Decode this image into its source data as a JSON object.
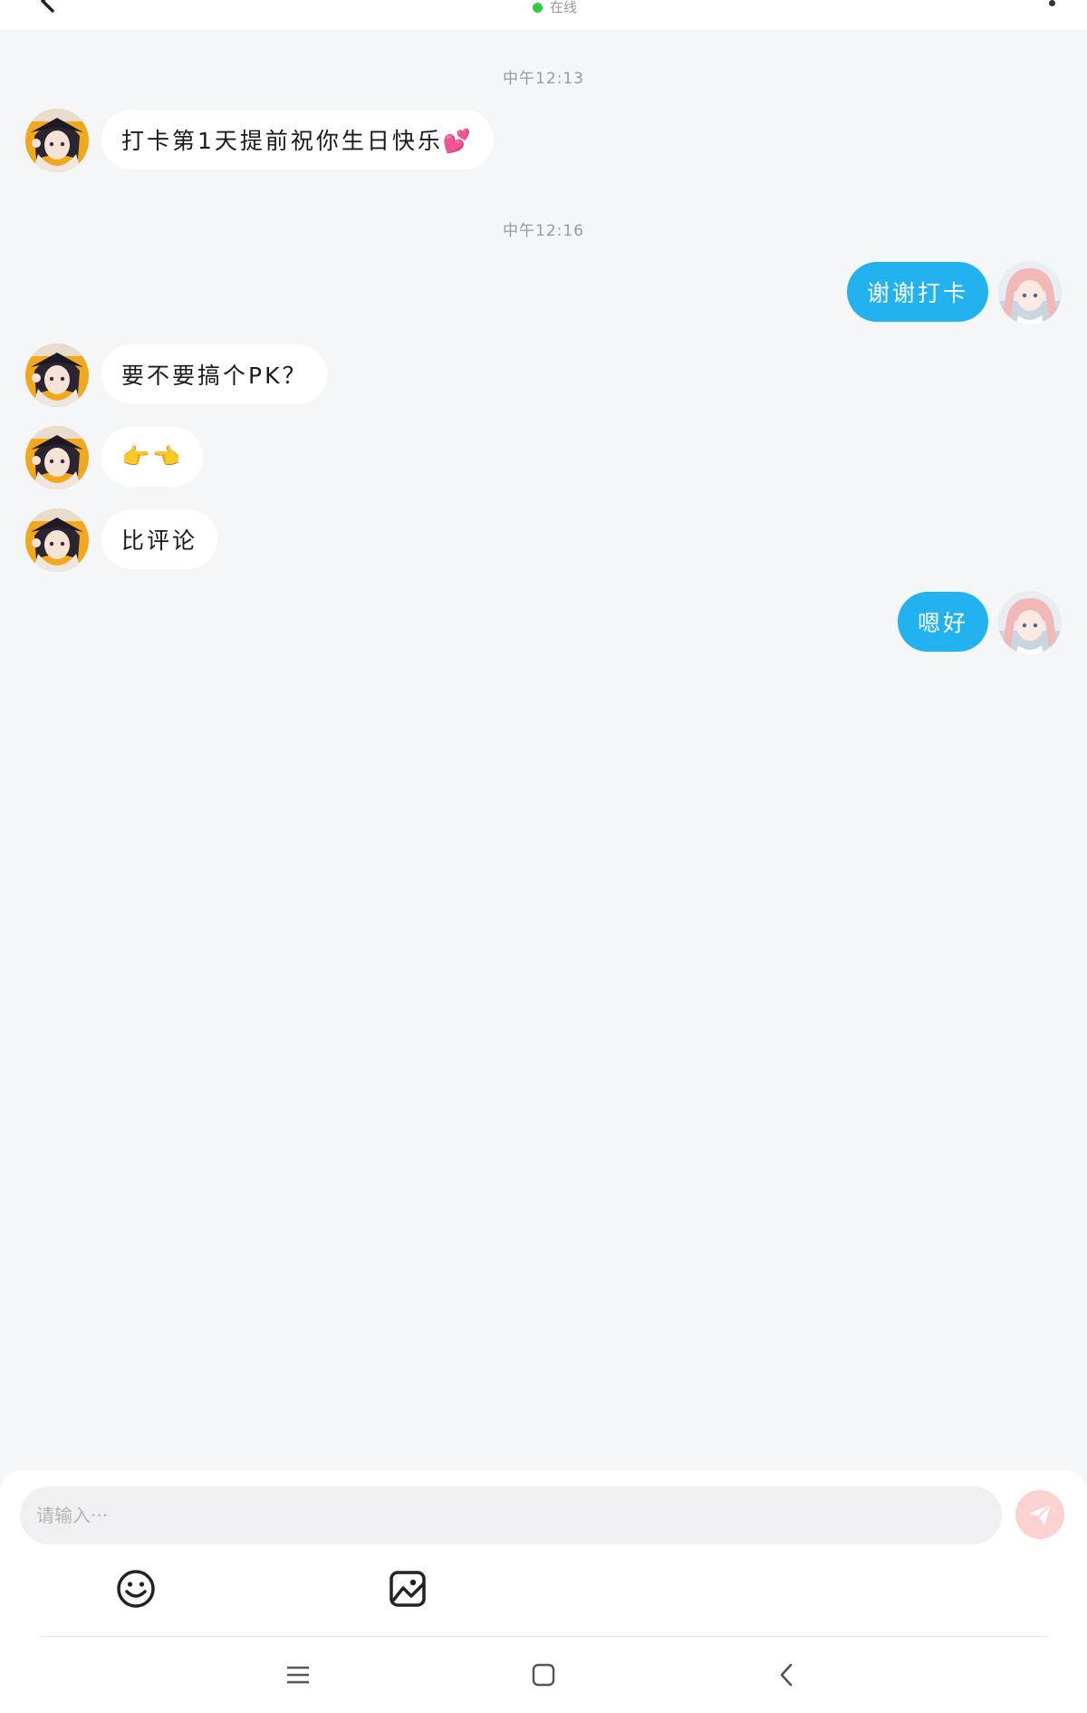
{
  "header": {
    "status_text": "在线",
    "status_color": "#2ecc40"
  },
  "icons": {
    "back": "back-arrow-icon",
    "more": "more-dot-icon",
    "send": "paper-plane-icon",
    "emoji": "smiley-icon",
    "image": "image-icon",
    "nav_menu": "menu-lines-icon",
    "nav_home": "rounded-square-icon",
    "nav_back": "chevron-left-icon"
  },
  "colors": {
    "outgoing_bubble": "#22b2f0",
    "incoming_bubble": "#ffffff",
    "send_button": "#fbd2d0",
    "background": "#f5f6f8"
  },
  "timestamps": [
    "中午12:13",
    "中午12:16"
  ],
  "messages": [
    {
      "side": "incoming",
      "text": "打卡第1天提前祝你生日快乐💕"
    },
    {
      "side": "outgoing",
      "text": "谢谢打卡"
    },
    {
      "side": "incoming",
      "text": "要不要搞个PK？"
    },
    {
      "side": "incoming",
      "text": "👉👈"
    },
    {
      "side": "incoming",
      "text": "比评论"
    },
    {
      "side": "outgoing",
      "text": "嗯好"
    }
  ],
  "composer": {
    "placeholder": "请输入···",
    "value": ""
  }
}
